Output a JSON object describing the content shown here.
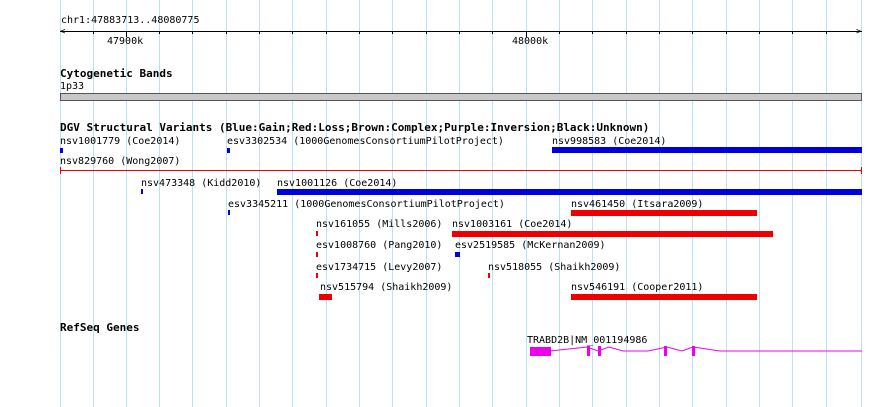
{
  "ruler": {
    "range": "chr1:47883713..48080775",
    "ticks": [
      "47900k",
      "48000k"
    ]
  },
  "cytoband": {
    "title": "Cytogenetic Bands",
    "label": "1p33"
  },
  "dgv": {
    "title": "DGV Structural Variants (Blue:Gain;Red:Loss;Brown:Complex;Purple:Inversion;Black:Unknown)",
    "colors": {
      "gain": "#0000dd",
      "loss": "#ee0000"
    },
    "features": [
      "nsv1001779 (Coe2014)",
      "esv3302534 (1000GenomesConsortiumPilotProject)",
      "nsv998583 (Coe2014)",
      "nsv829760 (Wong2007)",
      "nsv473348 (Kidd2010)",
      "nsv1001126 (Coe2014)",
      "esv3345211 (1000GenomesConsortiumPilotProject)",
      "nsv461450 (Itsara2009)",
      "nsv161055 (Mills2006)",
      "nsv1003161 (Coe2014)",
      "esv1008760 (Pang2010)",
      "esv2519585 (McKernan2009)",
      "esv1734715 (Levy2007)",
      "nsv518055 (Shaikh2009)",
      "nsv515794 (Shaikh2009)",
      "nsv546191 (Cooper2011)"
    ]
  },
  "refseq": {
    "title": "RefSeq Genes",
    "gene_label": "TRABD2B|NM_001194986",
    "color": "#ee00ee"
  }
}
